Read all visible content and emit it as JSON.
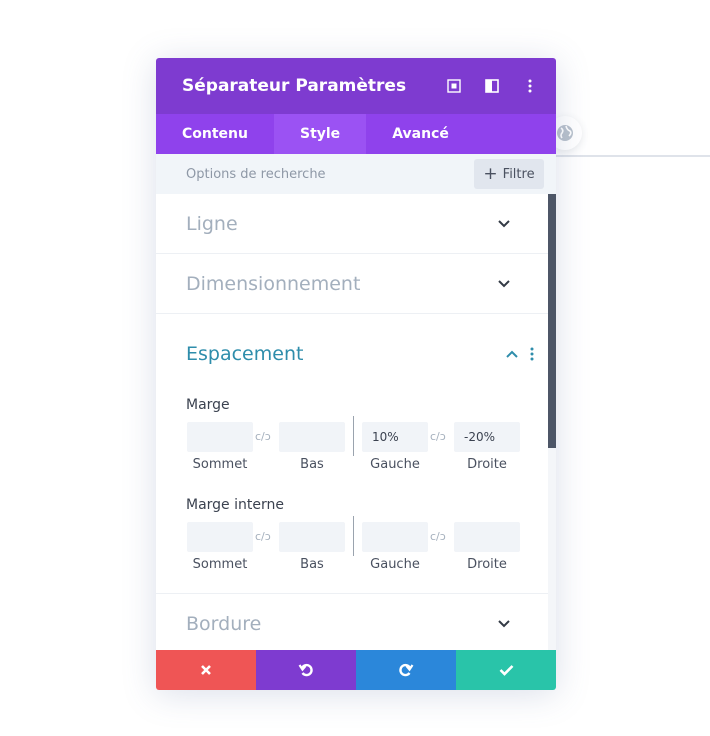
{
  "header": {
    "title": "Séparateur Paramètres",
    "icons": [
      "fullscreen-icon",
      "split-view-icon",
      "more-vertical-icon"
    ]
  },
  "tabs": [
    {
      "label": "Contenu",
      "active": false
    },
    {
      "label": "Style",
      "active": true
    },
    {
      "label": "Avancé",
      "active": false
    }
  ],
  "search": {
    "placeholder": "Options de recherche",
    "filter_label": "Filtre"
  },
  "sections": {
    "ligne": "Ligne",
    "dimensionnement": "Dimensionnement",
    "espacement": "Espacement",
    "bordure": "Bordure"
  },
  "spacing": {
    "margin": {
      "label": "Marge",
      "values": {
        "top": "",
        "bottom": "",
        "left": "10%",
        "right": "-20%"
      }
    },
    "padding": {
      "label": "Marge interne",
      "values": {
        "top": "",
        "bottom": "",
        "left": "",
        "right": ""
      }
    },
    "field_labels": {
      "top": "Sommet",
      "bottom": "Bas",
      "left": "Gauche",
      "right": "Droite"
    }
  },
  "footer": [
    "cancel-icon",
    "undo-icon",
    "redo-icon",
    "save-check-icon"
  ],
  "colors": {
    "header": "#7e3bd0",
    "tabs": "#8f42ec",
    "tab_active": "#9b52f3",
    "open_section": "#2e8dab",
    "cancel": "#ef5555",
    "undo": "#7e3bd0",
    "redo": "#2b87da",
    "save": "#29c4a9"
  }
}
